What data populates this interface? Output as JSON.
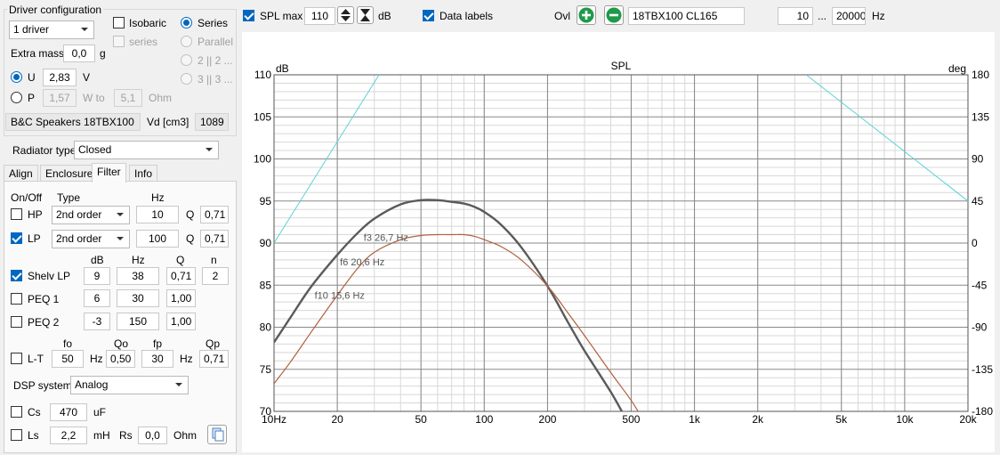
{
  "driver_config": {
    "group_title": "Driver configuration",
    "drivers_select": "1 driver",
    "isobaric_label": "Isobaric",
    "series_label": "Series",
    "series_cb_label": "series",
    "parallel_label": "Parallel",
    "opt_22_label": "2 || 2 ...",
    "opt_33_label": "3 || 3 ...",
    "extra_mass_label": "Extra mass",
    "extra_mass_value": "0,0",
    "extra_mass_unit": "g",
    "u_label": "U",
    "u_value": "2,83",
    "u_unit": "V",
    "p_label": "P",
    "p_value": "1,57",
    "p_unit": "W to",
    "ohm_value": "5,1",
    "ohm_unit": "Ohm",
    "driver_name": "B&C Speakers 18TBX100",
    "vd_label": "Vd [cm3]",
    "vd_value": "1089"
  },
  "radiator": {
    "label": "Radiator type",
    "value": "Closed"
  },
  "tabs": [
    {
      "label": "Align"
    },
    {
      "label": "Enclosure"
    },
    {
      "label": "Filter"
    },
    {
      "label": "Info"
    }
  ],
  "filter": {
    "onoff_header": "On/Off",
    "type_header": "Type",
    "hz_header": "Hz",
    "hp": {
      "label": "HP",
      "type": "2nd order",
      "hz": "10",
      "q_label": "Q",
      "q": "0,71",
      "enabled": false
    },
    "lp": {
      "label": "LP",
      "type": "2nd order",
      "hz": "100",
      "q_label": "Q",
      "q": "0,71",
      "enabled": true
    },
    "sub_headers": {
      "db": "dB",
      "hz": "Hz",
      "q": "Q",
      "n": "n"
    },
    "shelv_lp": {
      "label": "Shelv LP",
      "db": "9",
      "hz": "38",
      "q": "0,71",
      "n": "2",
      "enabled": true
    },
    "peq1": {
      "label": "PEQ 1",
      "db": "6",
      "hz": "30",
      "q": "1,00",
      "enabled": false
    },
    "peq2": {
      "label": "PEQ 2",
      "db": "-3",
      "hz": "150",
      "q": "1,00",
      "enabled": false
    },
    "lt_headers": {
      "fo": "fo",
      "qo": "Qo",
      "fp": "fp",
      "qp": "Qp"
    },
    "lt": {
      "label": "L-T",
      "fo": "50",
      "fo_unit": "Hz",
      "qo": "0,50",
      "fp": "30",
      "fp_unit": "Hz",
      "qp": "0,71",
      "enabled": false
    },
    "dsp_label": "DSP system",
    "dsp_value": "Analog",
    "cs": {
      "label": "Cs",
      "value": "470",
      "unit": "uF",
      "enabled": false
    },
    "ls": {
      "label": "Ls",
      "value": "2,2",
      "unit": "mH",
      "rs_label": "Rs",
      "rs_value": "0,0",
      "rs_unit": "Ohm",
      "enabled": false
    }
  },
  "toolbar": {
    "spl_max_label": "SPL max",
    "spl_max_value": "110",
    "spl_unit": "dB",
    "data_labels_label": "Data labels",
    "ovl_label": "Ovl",
    "driver_field": "18TBX100 CL165",
    "f_min": "10",
    "range_sep": "...",
    "f_max": "20000",
    "f_unit": "Hz"
  },
  "chart_data": {
    "type": "line",
    "title": "SPL",
    "ylabel": "dB",
    "y2label": "deg",
    "x_scale": "log",
    "xlim": [
      10,
      20000
    ],
    "ylim": [
      70,
      110
    ],
    "y2lim": [
      -180,
      180
    ],
    "x_ticks": [
      {
        "v": 10,
        "label": "10Hz"
      },
      {
        "v": 20,
        "label": "20"
      },
      {
        "v": 50,
        "label": "50"
      },
      {
        "v": 100,
        "label": "100"
      },
      {
        "v": 200,
        "label": "200"
      },
      {
        "v": 500,
        "label": "500"
      },
      {
        "v": 1000,
        "label": "1k"
      },
      {
        "v": 2000,
        "label": "2k"
      },
      {
        "v": 5000,
        "label": "5k"
      },
      {
        "v": 10000,
        "label": "10k"
      },
      {
        "v": 20000,
        "label": "20k"
      }
    ],
    "y_ticks": [
      70,
      75,
      80,
      85,
      90,
      95,
      100,
      105,
      110
    ],
    "y2_ticks": [
      "-180",
      "-135",
      "-90",
      "-45",
      "0",
      "45",
      "90",
      "135",
      "180"
    ],
    "grid": true,
    "colors": {
      "spl": "#5a5a5a",
      "spl2": "#b0603c",
      "phase": "#5ad2d8",
      "grid_major": "#888888",
      "grid_minor": "#d8d8d8"
    },
    "series": [
      {
        "id": "spl",
        "points": [
          [
            10,
            78.2
          ],
          [
            12,
            81.2
          ],
          [
            15,
            84.8
          ],
          [
            20,
            88.6
          ],
          [
            25,
            91.2
          ],
          [
            30,
            92.9
          ],
          [
            40,
            94.6
          ],
          [
            50,
            95.1
          ],
          [
            60,
            95.1
          ],
          [
            70,
            94.9
          ],
          [
            80,
            94.7
          ],
          [
            90,
            94.3
          ],
          [
            100,
            93.7
          ],
          [
            120,
            92.2
          ],
          [
            150,
            89.5
          ],
          [
            200,
            84.9
          ],
          [
            250,
            80.6
          ],
          [
            300,
            77.2
          ],
          [
            400,
            72.3
          ],
          [
            470,
            69.2
          ]
        ]
      },
      {
        "id": "spl2",
        "points": [
          [
            10,
            73.3
          ],
          [
            12,
            75.9
          ],
          [
            15,
            79.4
          ],
          [
            20,
            83.8
          ],
          [
            25,
            87.0
          ],
          [
            30,
            88.9
          ],
          [
            40,
            90.4
          ],
          [
            50,
            90.9
          ],
          [
            60,
            91.0
          ],
          [
            70,
            91.0
          ],
          [
            80,
            91.0
          ],
          [
            90,
            90.8
          ],
          [
            100,
            90.4
          ],
          [
            120,
            89.6
          ],
          [
            150,
            88.0
          ],
          [
            200,
            84.9
          ],
          [
            250,
            81.7
          ],
          [
            300,
            79.0
          ],
          [
            400,
            74.6
          ],
          [
            500,
            71.3
          ],
          [
            560,
            69.3
          ]
        ]
      },
      {
        "id": "phase_left",
        "points": [
          [
            10,
            0
          ],
          [
            31.6,
            180
          ]
        ]
      },
      {
        "id": "phase_right",
        "points": [
          [
            3400,
            180
          ],
          [
            20000,
            45
          ]
        ]
      }
    ],
    "annotations": [
      {
        "text": "f3 26,7 Hz",
        "x": 26.7,
        "y": 90.7
      },
      {
        "text": "f6 20,6 Hz",
        "x": 20.6,
        "y": 87.8
      },
      {
        "text": "f10 15,6 Hz",
        "x": 15.6,
        "y": 83.8
      }
    ]
  }
}
